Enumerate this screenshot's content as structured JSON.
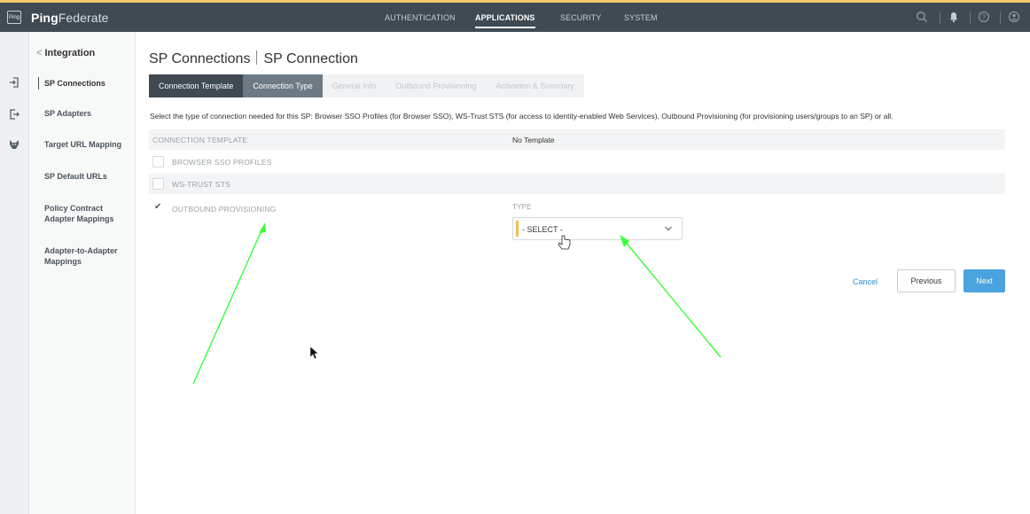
{
  "header": {
    "logo_text": "Ping",
    "brand_bold": "Ping",
    "brand_light": "Federate",
    "nav": [
      {
        "label": "AUTHENTICATION"
      },
      {
        "label": "APPLICATIONS"
      },
      {
        "label": "SECURITY"
      },
      {
        "label": "SYSTEM"
      }
    ],
    "active_nav": "APPLICATIONS",
    "icons": [
      "search-icon",
      "bell-icon",
      "help-icon",
      "user-icon"
    ]
  },
  "rail": {
    "icons": [
      "sign-in-icon",
      "sign-out-icon",
      "wolf-icon"
    ]
  },
  "sidebar": {
    "back_label": "Integration",
    "items": [
      {
        "label": "SP Connections"
      },
      {
        "label": "SP Adapters"
      },
      {
        "label": "Target URL Mapping"
      },
      {
        "label": "SP Default URLs"
      },
      {
        "label": "Policy Contract\nAdapter Mappings"
      },
      {
        "label": "Adapter-to-Adapter\nMappings"
      }
    ]
  },
  "main": {
    "title_left": "SP Connections",
    "title_right": "SP Connection",
    "tabs": [
      {
        "label": "Connection Template"
      },
      {
        "label": "Connection Type"
      },
      {
        "label": "General Info"
      },
      {
        "label": "Outbound Provisioning"
      },
      {
        "label": "Activation & Summary"
      }
    ],
    "description": "Select the type of connection needed for this SP: Browser SSO Profiles (for Browser SSO), WS-Trust STS (for access to identity-enabled Web Services), Outbound Provisioning (for provisioning users/groups to an SP) or all.",
    "template_row": {
      "label": "CONNECTION TEMPLATE",
      "value": "No Template"
    },
    "options": [
      {
        "label": "BROWSER SSO PROFILES",
        "checked": false
      },
      {
        "label": "WS-TRUST STS",
        "checked": false
      },
      {
        "label": "OUTBOUND PROVISIONING",
        "checked": true
      }
    ],
    "type_label": "TYPE",
    "type_select": "- SELECT -",
    "buttons": {
      "cancel": "Cancel",
      "previous": "Previous",
      "next": "Next"
    }
  },
  "colors": {
    "header_bg": "#3f4a53",
    "accent_blue": "#4aa3df",
    "annotation_arrow": "#39ff3a",
    "required_marker": "#f0c24a"
  }
}
